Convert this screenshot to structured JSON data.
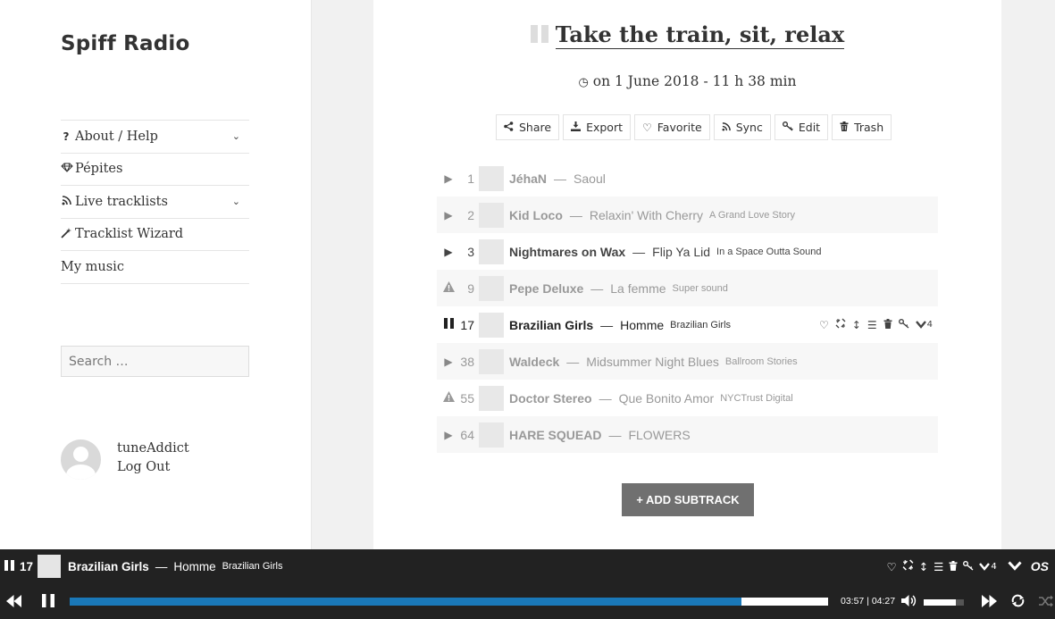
{
  "site": {
    "title": "Spiff Radio"
  },
  "menu": [
    {
      "icon": "?",
      "label": "About / Help",
      "has_children": true
    },
    {
      "icon": "◇",
      "label": "Pépites",
      "has_children": false
    },
    {
      "icon": "rss",
      "label": "Live tracklists",
      "has_children": true
    },
    {
      "icon": "wand",
      "label": "Tracklist Wizard",
      "has_children": false
    },
    {
      "icon": "",
      "label": "My music",
      "has_children": false
    }
  ],
  "search": {
    "placeholder": "Search …"
  },
  "user": {
    "name": "tuneAddict",
    "logout": "Log Out"
  },
  "post": {
    "title": "Take the train, sit, relax",
    "meta": "on 1 June 2018 - 11 h 38 min"
  },
  "actions": {
    "share": "Share",
    "export": "Export",
    "favorite": "Favorite",
    "sync": "Sync",
    "edit": "Edit",
    "trash": "Trash"
  },
  "tracks": [
    {
      "state": "play",
      "num": "1",
      "artist": "JéhaN",
      "title": "Saoul",
      "album": ""
    },
    {
      "state": "play",
      "num": "2",
      "artist": "Kid Loco",
      "title": "Relaxin' With Cherry",
      "album": "A Grand Love Story"
    },
    {
      "state": "play",
      "num": "3",
      "artist": "Nightmares on Wax",
      "title": "Flip Ya Lid",
      "album": "In a Space Outta Sound"
    },
    {
      "state": "warning",
      "num": "9",
      "artist": "Pepe Deluxe",
      "title": "La femme",
      "album": "Super sound"
    },
    {
      "state": "pause",
      "num": "17",
      "artist": "Brazilian Girls",
      "title": "Homme",
      "album": "Brazilian Girls",
      "tools_count": "4"
    },
    {
      "state": "play",
      "num": "38",
      "artist": "Waldeck",
      "title": "Midsummer Night Blues",
      "album": "Ballroom Stories"
    },
    {
      "state": "warning",
      "num": "55",
      "artist": "Doctor Stereo",
      "title": "Que Bonito Amor",
      "album": "NYCTrust Digital"
    },
    {
      "state": "play",
      "num": "64",
      "artist": "HARE SQUEAD",
      "title": "FLOWERS",
      "album": ""
    }
  ],
  "add_subtrack": "ADD SUBTRACK",
  "player": {
    "num": "17",
    "artist": "Brazilian Girls",
    "separator": "—",
    "title": "Homme",
    "album": "Brazilian Girls",
    "links_count": "4",
    "os_label": "OS",
    "time": "03:57 | 04:27",
    "progress": 0.886,
    "volume": 0.8
  },
  "colors": {
    "progress": "#1a78b8",
    "player_bg": "#222222",
    "add_button": "#707070"
  }
}
